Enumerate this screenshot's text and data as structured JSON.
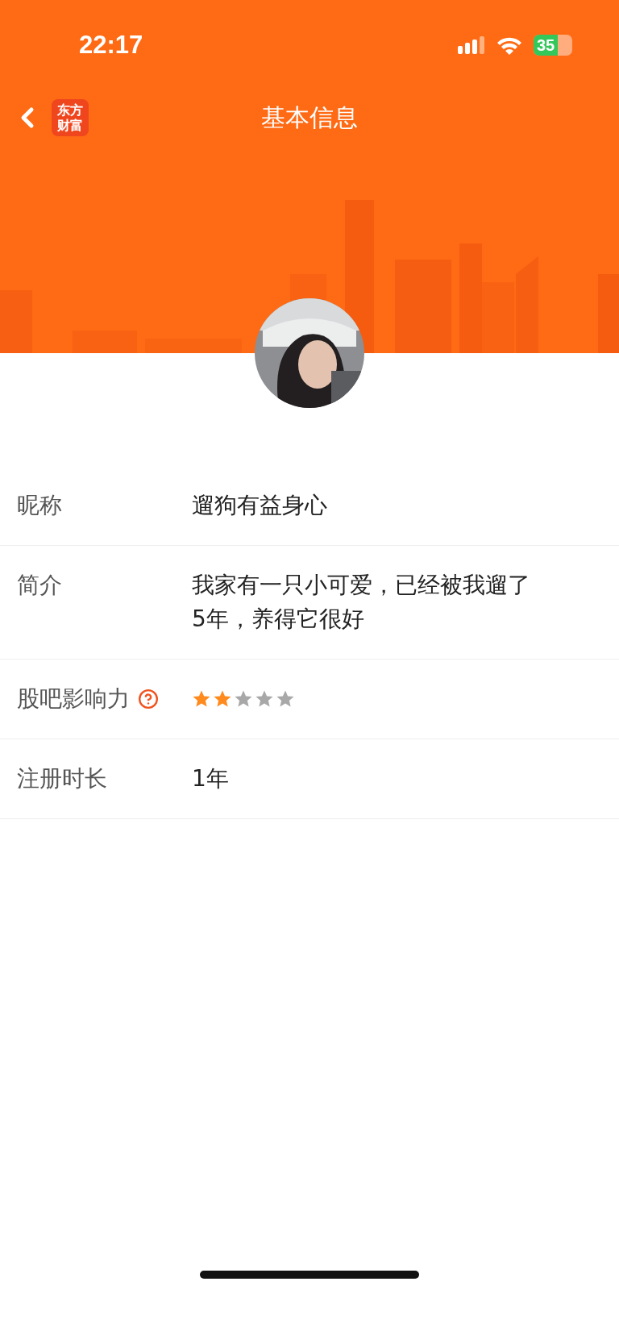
{
  "status_bar": {
    "time": "22:17",
    "battery": "35"
  },
  "nav": {
    "title": "基本信息",
    "logo_lines": [
      "东方",
      "财富"
    ]
  },
  "fields": [
    {
      "kind": "text",
      "label": "昵称",
      "value": "遛狗有益身心"
    },
    {
      "kind": "text",
      "label": "简介",
      "value": "我家有一只小可爱，已经被我遛了5年，养得它很好"
    },
    {
      "kind": "stars",
      "label": "股吧影响力",
      "help": true,
      "stars": 2
    },
    {
      "kind": "text",
      "label": "注册时长",
      "value": "1年"
    }
  ]
}
